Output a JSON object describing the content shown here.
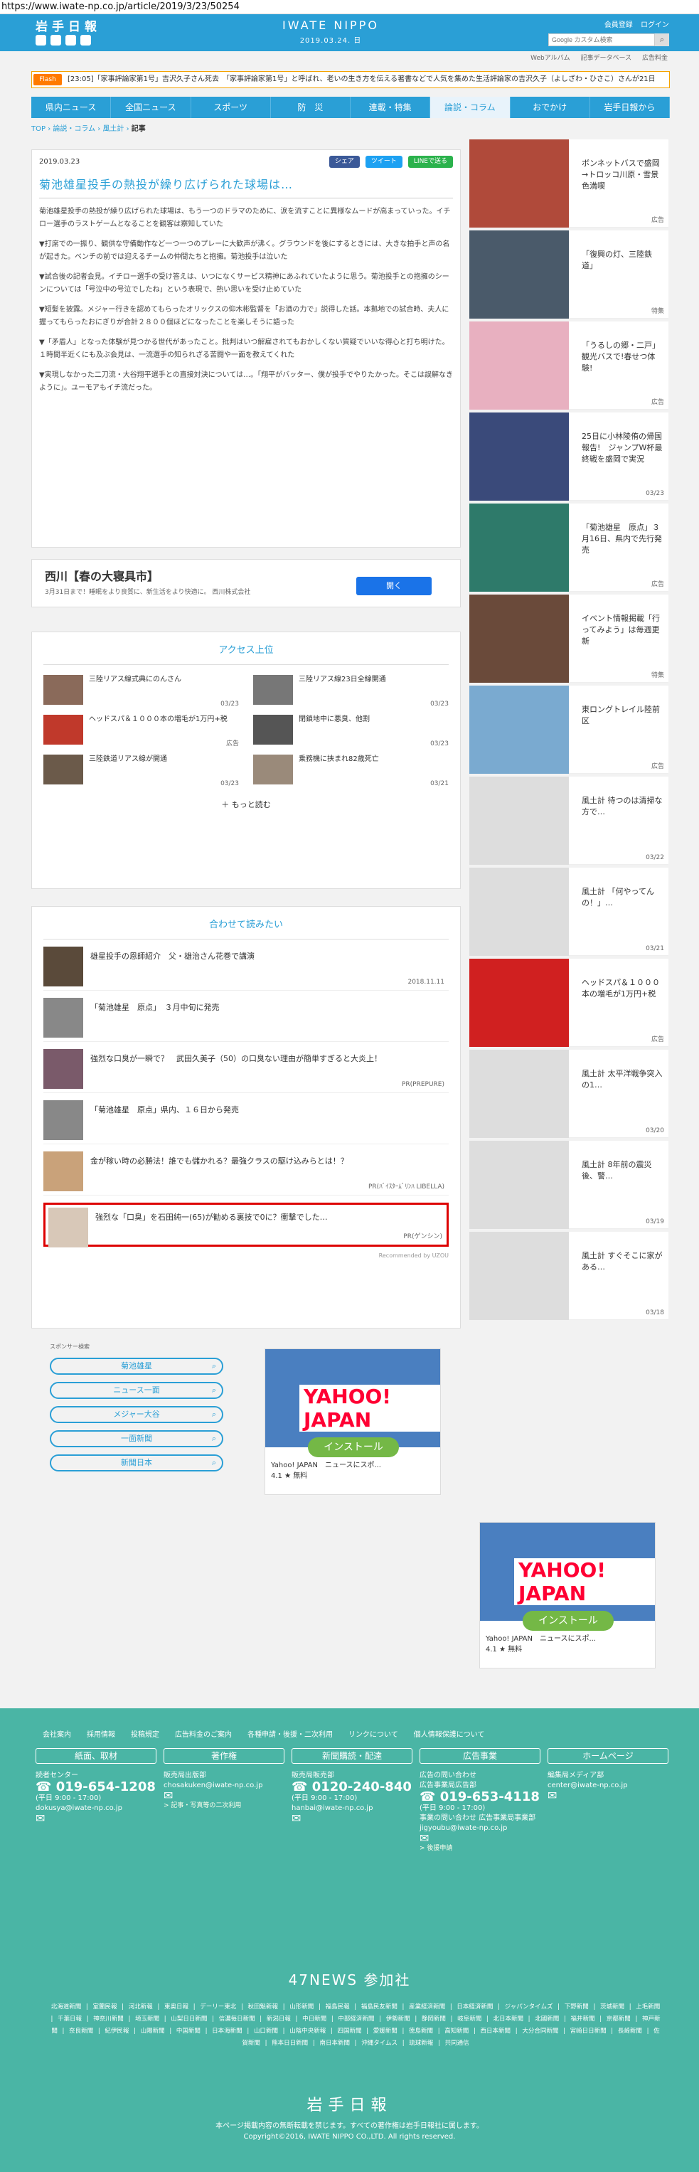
{
  "url": "https://www.iwate-np.co.jp/article/2019/3/23/50254",
  "header": {
    "logo": "岩手日報",
    "brand": "IWATE NIPPO",
    "date": "2019.03.24. 日",
    "links": [
      "会員登録",
      "ログイン"
    ],
    "search_placeholder": "Google カスタム検索",
    "subnav": [
      "Webアルバム",
      "記事データベース",
      "広告料金"
    ]
  },
  "flash": {
    "tag": "Flash",
    "text": "[23:05]「家事評論家第1号」吉沢久子さん死去　「家事評論家第1号」と呼ばれ、老いの生き方を伝える著書などで人気を集めた生活評論家の吉沢久子（よしざわ・ひさこ）さんが21日"
  },
  "nav": [
    "県内ニュース",
    "全国ニュース",
    "スポーツ",
    "防　災",
    "連載・特集",
    "論説・コラム",
    "おでかけ",
    "岩手日報から"
  ],
  "breadcrumb": [
    "TOP",
    "論説・コラム",
    "風土計",
    "記事"
  ],
  "article": {
    "date": "2019.03.23",
    "share": [
      "シェア",
      "ツイート",
      "LINEで送る"
    ],
    "title": "菊池雄星投手の熱投が繰り広げられた球場は…",
    "paragraphs": [
      "菊池雄星投手の熱投が繰り広げられた球場は、もう一つのドラマのために、涙を流すことに異様なムードが高まっていった。イチロー選手のラストゲームとなることを観客は察知していた",
      "▼打席での一振り、観供な守備動作など一つ一つのプレーに大歓声が沸く。グラウンドを後にするときには、大きな拍手と声の名が起きた。ベンチの前では迎えるチームの仲間たちと抱擁。菊池投手は泣いた",
      "▼試合後の記者会見。イチロー選手の受け答えは、いつになくサービス精神にあふれていたように思う。菊池投手との抱擁のシーンについては「号泣中の号泣でしたね」という表現で、熱い思いを受け止めていた",
      "▼短髪を披露。メジャー行きを認めてもらったオリックスの仰木彬監督を「お酒の力で」説得した話。本拠地での試合時、夫人に握ってもらったおにぎりが合計２８００個ほどになったことを楽しそうに語った",
      "▼「矛盾人」となった体験が見つかる世代があったこと。批判はいつ解雇されてもおかしくない質疑でいいな得心と打ち明けた。１時間半近くにも及ぶ会見は、一流選手の知られざる苦闘や一面を教えてくれた",
      "▼実現しなかった二刀流・大谷翔平選手との直接対決については…。「翔平がバッター、僕が投手でやりたかった。そこは誤解なきように」。ユーモアもイチ流だった。"
    ]
  },
  "ad_banner": {
    "title": "西川【春の大寝具市】",
    "sub": "3月31日まで！睡眠をより良質に、新生活をより快適に。 西川株式会社",
    "button": "開く"
  },
  "ranking": {
    "title": "アクセス上位",
    "items": [
      {
        "title": "三陸リアス線式典にのんさん",
        "date": "03/23"
      },
      {
        "title": "三陸リアス線23日全線開通",
        "date": "03/23"
      },
      {
        "title": "ヘッドスパ＆１０００本の増毛が1万円+税",
        "date": "広告"
      },
      {
        "title": "閉鎖地中に悪臭、他割",
        "date": "03/23"
      },
      {
        "title": "三陸鉄道リアス線が開通",
        "date": "03/23"
      },
      {
        "title": "乗務機に挟まれ82歳死亡",
        "date": "03/21"
      }
    ],
    "more": "もっと読む"
  },
  "related": {
    "title": "合わせて読みたい",
    "items": [
      {
        "title": "雄星投手の恩師紹介　父・雄治さん花巻で講演",
        "date": "2018.11.11"
      },
      {
        "title": "「菊池雄星　原点」　３月中旬に発売",
        "date": ""
      },
      {
        "title": "強烈な口臭が一瞬で？　武田久美子（50）の口臭ない理由が簡単すぎると大炎上！",
        "date": "PR(PREPURE)"
      },
      {
        "title": "「菊池雄星　原点」県内、１６日から発売",
        "date": ""
      },
      {
        "title": "金が稼い時の必勝法！誰でも儲かれる？最強クラスの駆け込みらとは！？",
        "date": "PR(ﾊﾞｲｽﾀｰﾑﾞﾘﾝﾊ LIBELLA)"
      },
      {
        "title": "強烈な「口臭」を石田純一(65)が勧める裏技で0に？衝撃でした…",
        "date": "PR(ゲンシン)"
      }
    ],
    "powered": "Recommended by UZOU"
  },
  "sponsor": {
    "label": "スポンサー検索",
    "items": [
      "菊池雄星",
      "ニュース一面",
      "メジャー大谷",
      "一面新聞",
      "新聞日本"
    ]
  },
  "yahoo_ad": {
    "logo": "YAHOO! JAPAN",
    "install": "インストール",
    "name": "Yahoo! JAPAN　ニュースにスポ...",
    "rating": "4.1 ★ 無料"
  },
  "sidebar": [
    {
      "title": "ボンネットバスで盛岡→トロッコ川原・雪景色満喫",
      "date": "広告"
    },
    {
      "title": "「復興の灯、三陸鉄道」",
      "date": "特集"
    },
    {
      "title": "「うるしの郷・二戸」観光バスで!春せつ体験!",
      "date": "広告"
    },
    {
      "title": "25日に小林陵侑の帰国報告!　ジャンプW杯最終戦を盛岡で実況",
      "date": "03/23"
    },
    {
      "title": "「菊池雄星　原点」３月16日、県内で先行発売",
      "date": "広告"
    },
    {
      "title": "イベント情報掲載「行ってみよう」は毎週更新",
      "date": "特集"
    },
    {
      "title": "東ロングトレイル陸前区",
      "date": "広告"
    },
    {
      "title": "風土計 待つのは清掃な方で…",
      "date": "03/22"
    },
    {
      "title": "風土計 「何やってんの！」…",
      "date": "03/21"
    },
    {
      "title": "ヘッドスパ＆１０００本の増毛が1万円+税",
      "date": "広告"
    },
    {
      "title": "風土計 太平洋戦争突入の1…",
      "date": "03/20"
    },
    {
      "title": "風土計 8年前の震災後、警…",
      "date": "03/19"
    },
    {
      "title": "風土計 すぐそこに家がある…",
      "date": "03/18"
    }
  ],
  "footer": {
    "links": [
      "会社案内",
      "採用情報",
      "投稿規定",
      "広告料金のご案内",
      "各種申請・後援・二次利用",
      "リンクについて",
      "個人情報保護について"
    ],
    "cols": [
      {
        "head": "紙面、取材",
        "lines": [
          "読者センター"
        ],
        "phone": "019-654-1208",
        "hours": "(平日 9:00 - 17:00)",
        "email": "dokusya@iwate-np.co.jp"
      },
      {
        "head": "著作権",
        "lines": [
          "販売局出版部"
        ],
        "phone": "",
        "hours": "",
        "email": "chosakuken@iwate-np.co.jp",
        "link": "> 記事・写真等の二次利用"
      },
      {
        "head": "新聞購読・配達",
        "lines": [
          "販売局販売部"
        ],
        "phone": "0120-240-840",
        "hours": "(平日 9:00 - 17:00)",
        "email": "hanbai@iwate-np.co.jp"
      },
      {
        "head": "広告事業",
        "lines": [
          "広告の問い合わせ",
          "広告事業局広告部"
        ],
        "phone": "019-653-4118",
        "hours": "(平日 9:00 - 17:00)",
        "email": "事業の問い合わせ 広告事業局事業部 jigyoubu@iwate-np.co.jp",
        "link": "> 後援申請"
      },
      {
        "head": "ホームページ",
        "lines": [
          "編集局メディア部"
        ],
        "phone": "",
        "hours": "",
        "email": "center@iwate-np.co.jp"
      }
    ],
    "news47": "47NEWS 参加社",
    "members": "北海道新聞 | 室蘭民報 | 河北新報 | 東奥日報 | デーリー東北 | 秋田魁新報 | 山形新聞 | 福島民報 | 福島民友新聞 | 産業経済新聞 | 日本経済新聞 | ジャパンタイムズ | 下野新聞 | 茨城新聞 | 上毛新聞 | 千葉日報 | 神奈川新聞 | 埼玉新聞 | 山梨日日新聞 | 信濃毎日新聞 | 新潟日報 | 中日新聞 | 中部経済新聞 | 伊勢新聞 | 静岡新聞 | 岐阜新聞 | 北日本新聞 | 北國新聞 | 福井新聞 | 京都新聞 | 神戸新聞 | 奈良新聞 | 紀伊民報 | 山陽新聞 | 中国新聞 | 日本海新聞 | 山口新聞 | 山陰中央新報 | 四国新聞 | 愛媛新聞 | 徳島新聞 | 高知新聞 | 西日本新聞 | 大分合同新聞 | 宮崎日日新聞 | 長崎新聞 | 佐賀新聞 | 熊本日日新聞 | 南日本新聞 | 沖縄タイムス | 琉球新報 | 共同通信",
    "logo": "岩手日報",
    "note1": "本ページ掲載内容の無断転載を禁じます。すべての著作権は岩手日報社に属します。",
    "copyright": "Copyright©2016, IWATE NIPPO CO.,LTD. All rights reserved."
  }
}
